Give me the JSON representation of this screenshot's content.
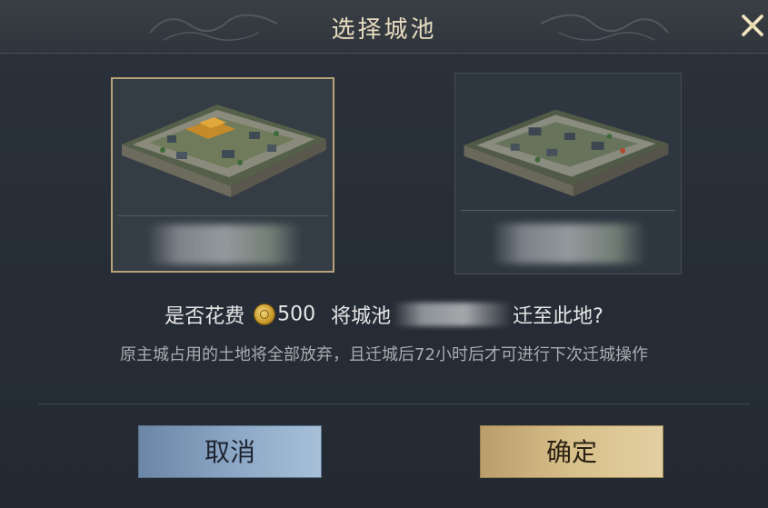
{
  "dialog": {
    "title": "选择城池"
  },
  "cities": [
    {
      "name": "",
      "selected": true
    },
    {
      "name": "",
      "selected": false
    }
  ],
  "prompt": {
    "prefix": "是否花费",
    "cost": "500",
    "middle": "将城池",
    "suffix": "迁至此地?"
  },
  "notice": "原主城占用的土地将全部放弃，且迁城后72小时后才可进行下次迁城操作",
  "buttons": {
    "cancel": "取消",
    "confirm": "确定"
  },
  "icons": {
    "close": "close-icon",
    "currency": "coin-icon"
  },
  "colors": {
    "title_gold": "#e8dcc0",
    "selected_border": "#b8a27a",
    "cancel_blue": "#8ea9c7",
    "confirm_gold": "#d8c08a"
  }
}
